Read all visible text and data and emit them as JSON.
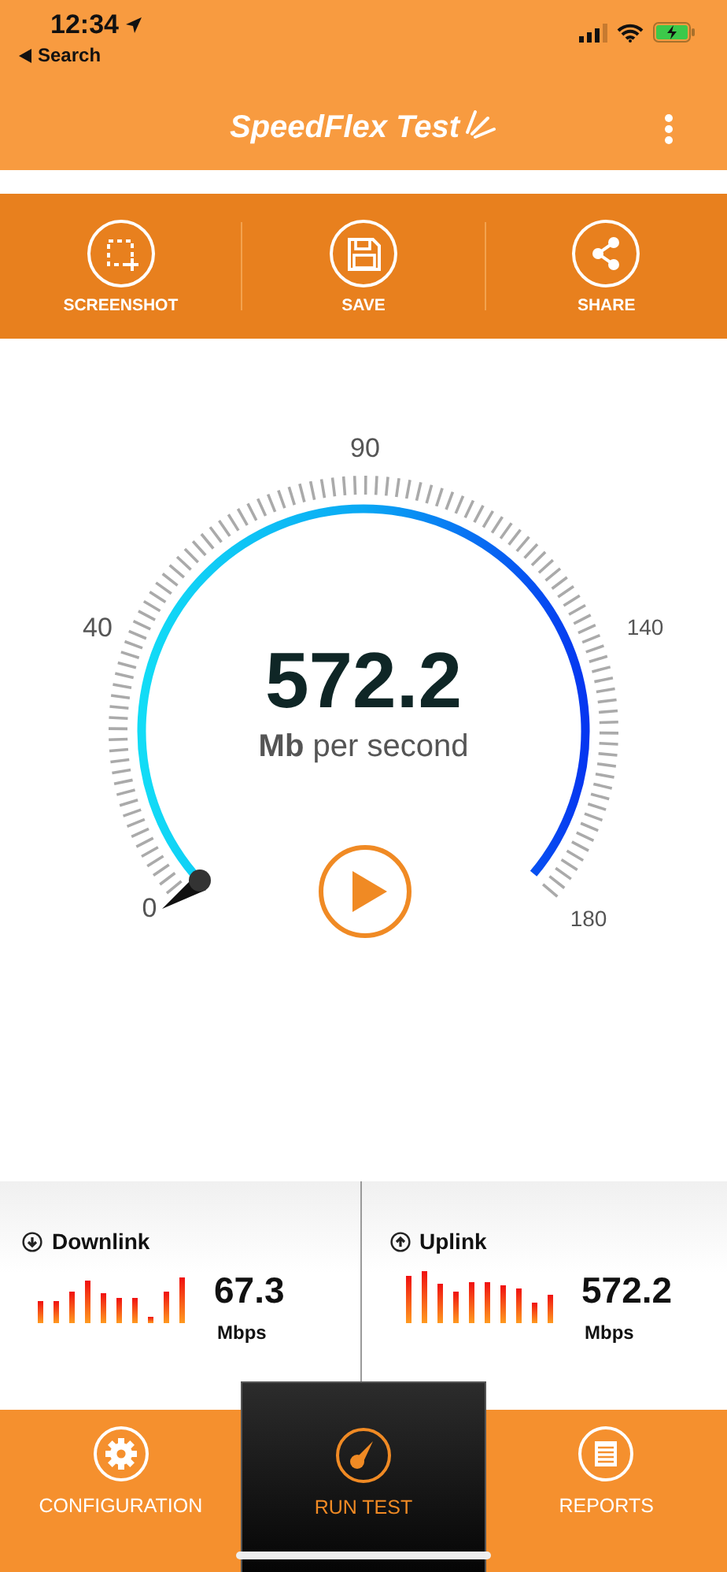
{
  "status_bar": {
    "time": "12:34",
    "back_label": "Search"
  },
  "header": {
    "title": "SpeedFlex Test"
  },
  "actions": [
    {
      "label": "SCREENSHOT",
      "kind": "screenshot"
    },
    {
      "label": "SAVE",
      "kind": "save"
    },
    {
      "label": "SHARE",
      "kind": "share"
    }
  ],
  "gauge": {
    "scale_labels": [
      "0",
      "40",
      "90",
      "140",
      "180"
    ],
    "value": "572.2",
    "unit": "**Mb** per second"
  },
  "stats": [
    {
      "kind": "downlink",
      "label": "Downlink",
      "value": "67.3",
      "unit": "Mbps"
    },
    {
      "kind": "uplink",
      "label": "Uplink",
      "value": "572.2",
      "unit": "Mbps"
    }
  ],
  "nav": [
    {
      "kind": "configuration",
      "label": "CONFIGURATION",
      "selected": false
    },
    {
      "kind": "run",
      "label": "RUN TEST",
      "selected": true
    },
    {
      "kind": "reports",
      "label": "REPORTS",
      "selected": false
    }
  ]
}
